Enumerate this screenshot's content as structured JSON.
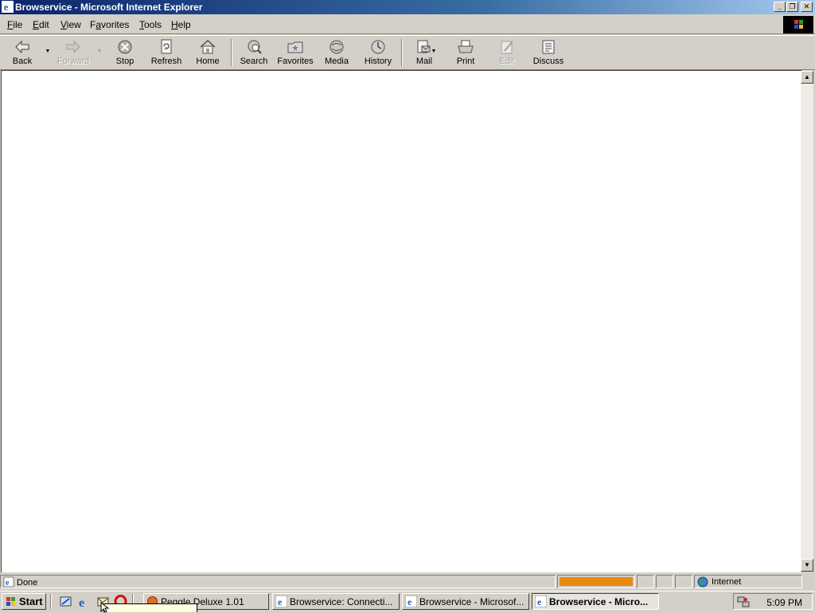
{
  "window": {
    "title": "Browservice - Microsoft Internet Explorer",
    "controls": {
      "minimize": "_",
      "restore": "❐",
      "close": "✕"
    }
  },
  "menubar": {
    "items": [
      {
        "acc": "F",
        "rest": "ile"
      },
      {
        "acc": "E",
        "rest": "dit"
      },
      {
        "acc": "V",
        "rest": "iew"
      },
      {
        "acc": "",
        "pre": "F",
        "acc2": "a",
        "rest": "vorites"
      },
      {
        "acc": "T",
        "rest": "ools"
      },
      {
        "acc": "H",
        "rest": "elp"
      }
    ]
  },
  "toolbar": {
    "back": "Back",
    "forward": "Forward",
    "stop": "Stop",
    "refresh": "Refresh",
    "home": "Home",
    "search": "Search",
    "favorites": "Favorites",
    "media": "Media",
    "history": "History",
    "mail": "Mail",
    "print": "Print",
    "edit": "Edit",
    "discuss": "Discuss"
  },
  "statusbar": {
    "status": "Done",
    "progress": 1.0,
    "zone": "Internet"
  },
  "taskbar": {
    "start": "Start",
    "tasks": [
      {
        "label": "Peggle Deluxe 1.01",
        "active": false
      },
      {
        "label": "Browservice: Connecti...",
        "active": false
      },
      {
        "label": "Browservice - Microsof...",
        "active": false
      },
      {
        "label": "Browservice - Micro...",
        "active": true
      }
    ],
    "clock": "5:09 PM"
  },
  "colors": {
    "titlebar_start": "#0a246a",
    "titlebar_end": "#a6caf0",
    "chrome": "#d4d0c8",
    "progress": "#e88a10"
  },
  "icons": [
    "ie-icon",
    "back-arrow-icon",
    "forward-arrow-icon",
    "stop-icon",
    "refresh-icon",
    "home-icon",
    "search-icon",
    "favorites-icon",
    "media-icon",
    "history-icon",
    "mail-icon",
    "print-icon",
    "edit-icon",
    "discuss-icon",
    "windows-flag-icon",
    "globe-icon"
  ]
}
